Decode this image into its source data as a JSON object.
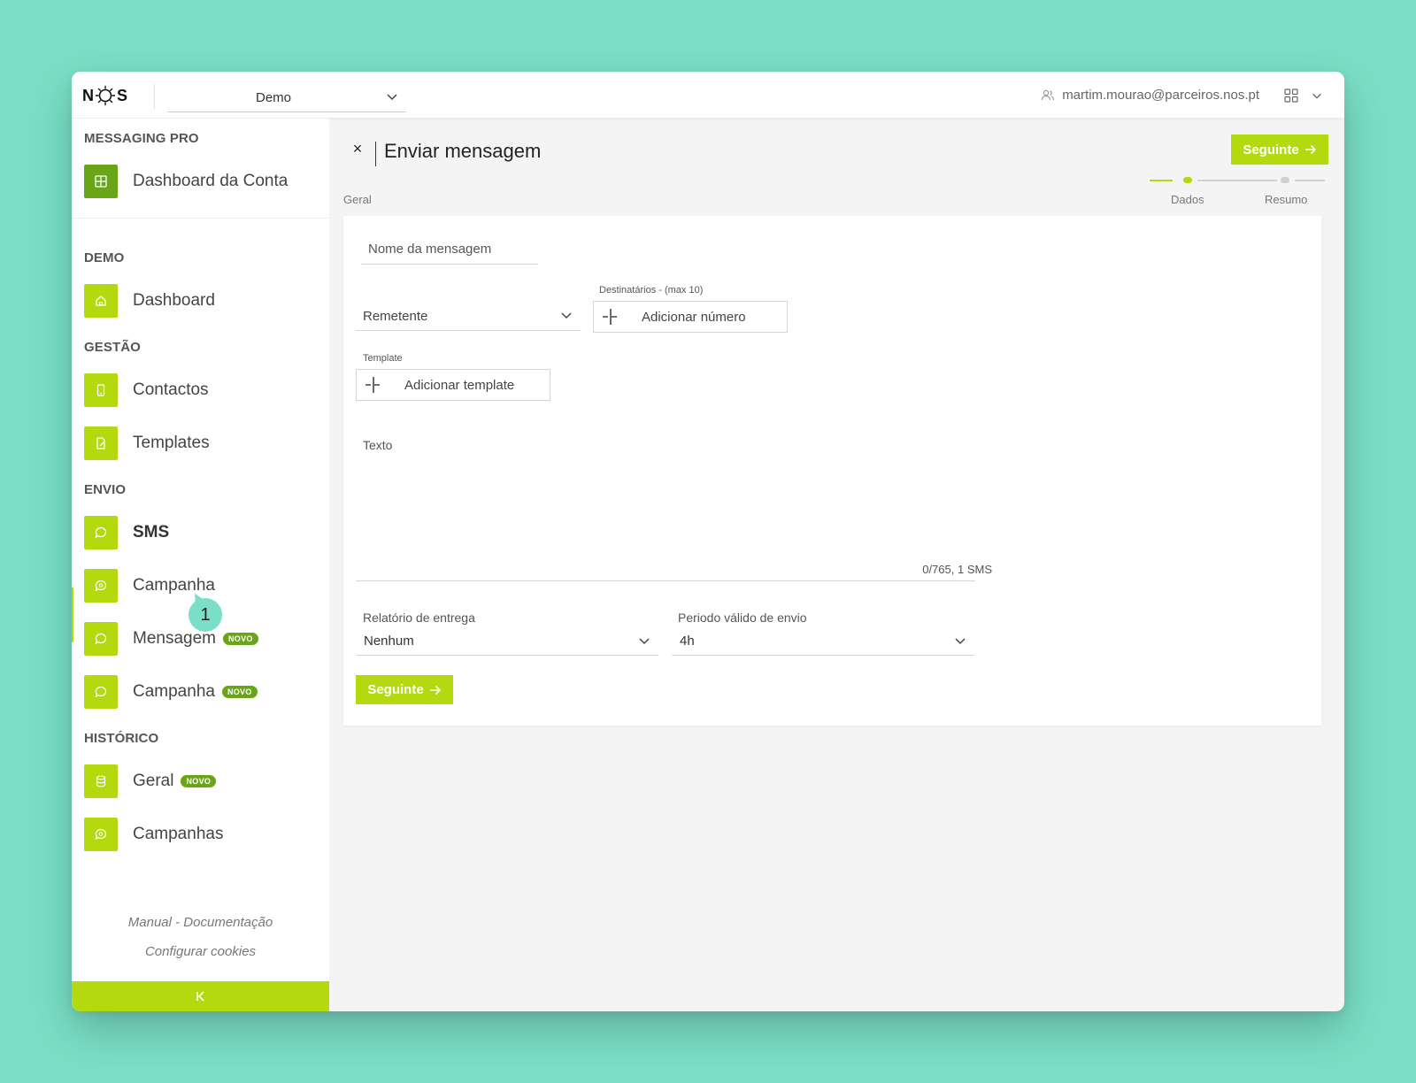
{
  "topbar": {
    "logo": {
      "n": "N",
      "s": "S"
    },
    "environment": "Demo",
    "user_email": "martim.mourao@parceiros.nos.pt"
  },
  "sidebar": {
    "product_title": "MESSAGING PRO",
    "account_dashboard": "Dashboard da Conta",
    "sections": {
      "demo": "DEMO",
      "gestao": "GESTÃO",
      "envio": "ENVIO",
      "historico": "HISTÓRICO"
    },
    "items": {
      "dashboard": "Dashboard",
      "contactos": "Contactos",
      "templates": "Templates",
      "sms": "SMS",
      "campanha": "Campanha",
      "mensagem": "Mensagem",
      "campanha_novo": "Campanha",
      "geral": "Geral",
      "campanhas": "Campanhas"
    },
    "badge": "NOVO",
    "tooltip_number": "1",
    "footer": {
      "manual": "Manual - Documentação",
      "cookies": "Configurar cookies"
    }
  },
  "main": {
    "title": "Enviar mensagem",
    "close_label": "×",
    "next_label": "Seguinte",
    "breadcrumb": "Geral",
    "steps": [
      "Dados",
      "Resumo"
    ],
    "accent_color": "#b5d90f",
    "form": {
      "message_name_placeholder": "Nome da mensagem",
      "sender_placeholder": "Remetente",
      "recipients_label": "Destinatários - (max 10)",
      "add_number": "Adicionar número",
      "template_label": "Template",
      "add_template": "Adicionar template",
      "text_label": "Texto",
      "counter": "0/765, 1 SMS",
      "delivery_report_label": "Relatório de entrega",
      "delivery_report_value": "Nenhum",
      "valid_period_label": "Periodo válido de envio",
      "valid_period_value": "4h",
      "next_label": "Seguinte"
    }
  }
}
